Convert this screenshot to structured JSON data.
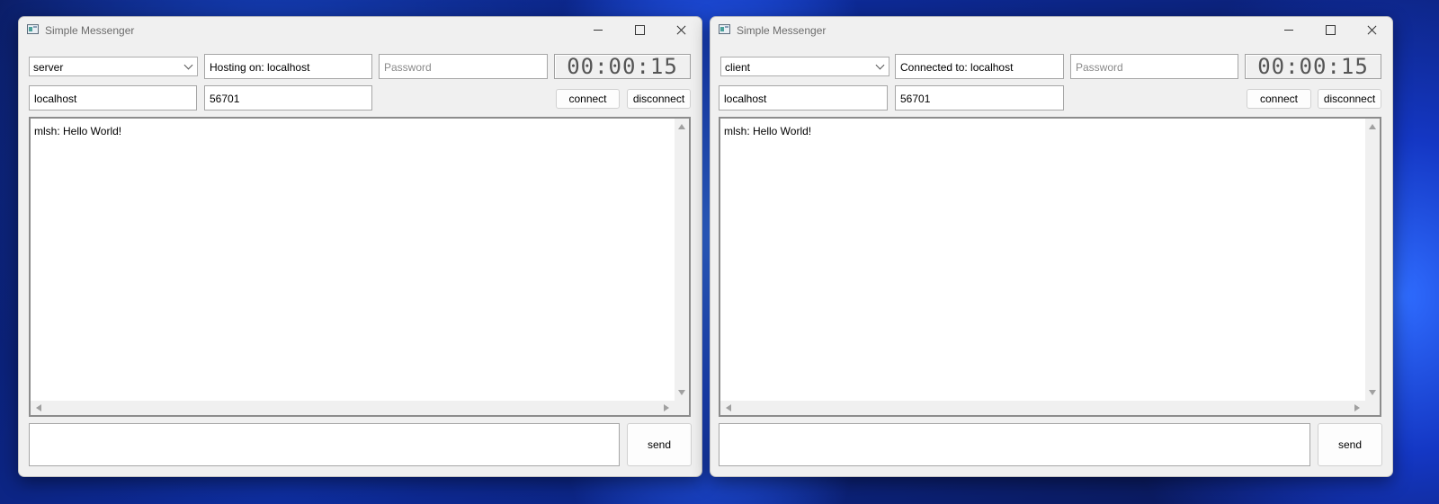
{
  "windows": [
    {
      "title": "Simple Messenger",
      "mode": "server",
      "status": "Hosting on: localhost",
      "password_placeholder": "Password",
      "timer": "00:00:15",
      "host": "localhost",
      "port": "56701",
      "connect_label": "connect",
      "disconnect_label": "disconnect",
      "messages": [
        "mlsh: Hello World!"
      ],
      "send_label": "send"
    },
    {
      "title": "Simple Messenger",
      "mode": "client",
      "status": "Connected to: localhost",
      "password_placeholder": "Password",
      "timer": "00:00:15",
      "host": "localhost",
      "port": "56701",
      "connect_label": "connect",
      "disconnect_label": "disconnect",
      "messages": [
        "mlsh: Hello World!"
      ],
      "send_label": "send"
    }
  ]
}
